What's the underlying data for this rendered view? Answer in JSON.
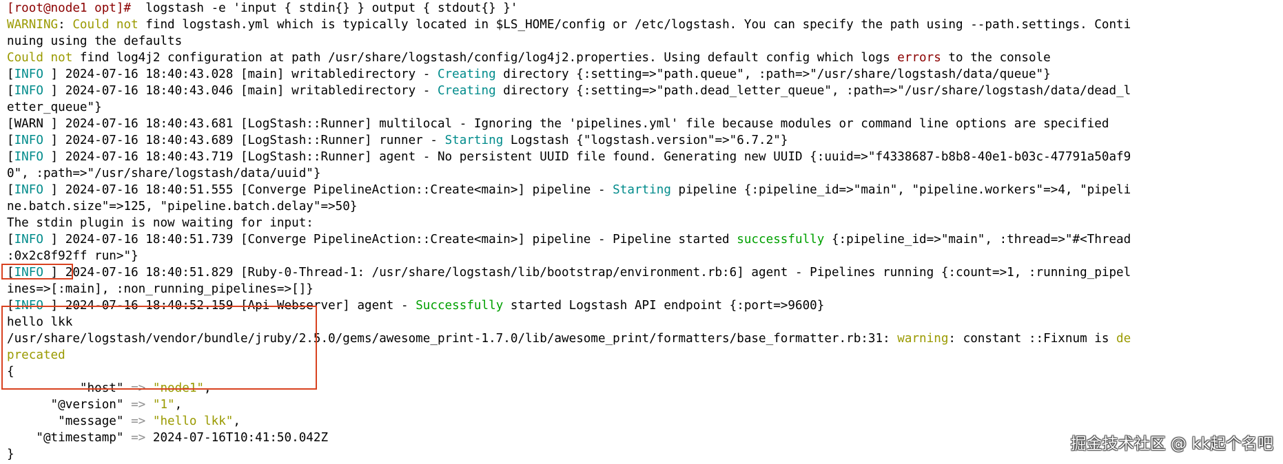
{
  "terminal": {
    "lines": [
      [
        {
          "t": "[root@node1 opt]#",
          "c": "root"
        },
        {
          "t": "  logstash -e 'input { stdin{} } output { stdout{} }'"
        }
      ],
      [
        {
          "t": "WARNING",
          "c": "olive"
        },
        {
          "t": ": "
        },
        {
          "t": "Could not",
          "c": "olive"
        },
        {
          "t": " find logstash.yml which is typically located in $LS_HOME/config or /etc/logstash. You can specify the path using --path.settings. Conti"
        }
      ],
      [
        {
          "t": "nuing using the defaults"
        }
      ],
      [
        {
          "t": "Could not",
          "c": "olive"
        },
        {
          "t": " find log4j2 configuration at path /usr/share/logstash/config/log4j2.properties. Using default config which logs "
        },
        {
          "t": "errors",
          "c": "red"
        },
        {
          "t": " to the console"
        }
      ],
      [
        {
          "t": "["
        },
        {
          "t": "INFO",
          "c": "cyan"
        },
        {
          "t": " ] 2024-07-16 18:40:43.028 [main] writabledirectory - "
        },
        {
          "t": "Creating",
          "c": "cyan"
        },
        {
          "t": " directory {:setting=>\"path.queue\", :path=>\"/usr/share/logstash/data/queue\"}"
        }
      ],
      [
        {
          "t": "["
        },
        {
          "t": "INFO",
          "c": "cyan"
        },
        {
          "t": " ] 2024-07-16 18:40:43.046 [main] writabledirectory - "
        },
        {
          "t": "Creating",
          "c": "cyan"
        },
        {
          "t": " directory {:setting=>\"path.dead_letter_queue\", :path=>\"/usr/share/logstash/data/dead_l"
        }
      ],
      [
        {
          "t": "etter_queue\"}"
        }
      ],
      [
        {
          "t": "[WARN ] 2024-07-16 18:40:43.681 [LogStash::Runner] multilocal - Ignoring the 'pipelines.yml' file because modules or command line options are specified"
        }
      ],
      [
        {
          "t": "["
        },
        {
          "t": "INFO",
          "c": "cyan"
        },
        {
          "t": " ] 2024-07-16 18:40:43.689 [LogStash::Runner] runner - "
        },
        {
          "t": "Starting",
          "c": "cyan"
        },
        {
          "t": " Logstash {\"logstash.version\"=>\"6.7.2\"}"
        }
      ],
      [
        {
          "t": "["
        },
        {
          "t": "INFO",
          "c": "cyan"
        },
        {
          "t": " ] 2024-07-16 18:40:43.719 [LogStash::Runner] agent - No persistent UUID file found. Generating new UUID {:uuid=>\"f4338687-b8b8-40e1-b03c-47791a50af9"
        }
      ],
      [
        {
          "t": "0\", :path=>\"/usr/share/logstash/data/uuid\"}"
        }
      ],
      [
        {
          "t": "["
        },
        {
          "t": "INFO",
          "c": "cyan"
        },
        {
          "t": " ] 2024-07-16 18:40:51.555 [Converge PipelineAction::Create<main>] pipeline - "
        },
        {
          "t": "Starting",
          "c": "cyan"
        },
        {
          "t": " pipeline {:pipeline_id=>\"main\", \"pipeline.workers\"=>4, \"pipeli"
        }
      ],
      [
        {
          "t": "ne.batch.size\"=>125, \"pipeline.batch.delay\"=>50}"
        }
      ],
      [
        {
          "t": "The stdin plugin is now waiting for input:"
        }
      ],
      [
        {
          "t": "["
        },
        {
          "t": "INFO",
          "c": "cyan"
        },
        {
          "t": " ] 2024-07-16 18:40:51.739 [Converge PipelineAction::Create<main>] pipeline - Pipeline started "
        },
        {
          "t": "successfully",
          "c": "green"
        },
        {
          "t": " {:pipeline_id=>\"main\", :thread=>\"#<Thread"
        }
      ],
      [
        {
          "t": ":0x2c8f92ff run>\"}"
        }
      ],
      [
        {
          "t": "["
        },
        {
          "t": "INFO",
          "c": "cyan"
        },
        {
          "t": " ] 2024-07-16 18:40:51.829 [Ruby-0-Thread-1: /usr/share/logstash/lib/bootstrap/environment.rb:6] agent - Pipelines running {:count=>1, :running_pipel"
        }
      ],
      [
        {
          "t": "ines=>[:main], :non_running_pipelines=>[]}"
        }
      ],
      [
        {
          "t": "["
        },
        {
          "t": "INFO",
          "c": "cyan"
        },
        {
          "t": " ] 2024-07-16 18:40:52.159 [Api Webserver] agent - "
        },
        {
          "t": "Successfully",
          "c": "green"
        },
        {
          "t": " started Logstash API endpoint {:port=>9600}"
        }
      ],
      [
        {
          "t": "hello lkk"
        }
      ],
      [
        {
          "t": "/usr/share/logstash/vendor/bundle/jruby/2.5.0/gems/awesome_print-1.7.0/lib/awesome_print/formatters/base_formatter.rb:31: "
        },
        {
          "t": "warning",
          "c": "olive"
        },
        {
          "t": ": constant ::Fixnum is "
        },
        {
          "t": "de",
          "c": "olive"
        }
      ],
      [
        {
          "t": "precated",
          "c": "olive"
        }
      ],
      [
        {
          "t": "{"
        }
      ],
      [
        {
          "t": "          \"host\" "
        },
        {
          "t": "=>",
          "c": "op"
        },
        {
          "t": " "
        },
        {
          "t": "\"node1\"",
          "c": "olive"
        },
        {
          "t": ","
        }
      ],
      [
        {
          "t": "      \"@version\" "
        },
        {
          "t": "=>",
          "c": "op"
        },
        {
          "t": " "
        },
        {
          "t": "\"1\"",
          "c": "olive"
        },
        {
          "t": ","
        }
      ],
      [
        {
          "t": "       \"message\" "
        },
        {
          "t": "=>",
          "c": "op"
        },
        {
          "t": " "
        },
        {
          "t": "\"hello lkk\"",
          "c": "olive"
        },
        {
          "t": ","
        }
      ],
      [
        {
          "t": "    \"@timestamp\" "
        },
        {
          "t": "=>",
          "c": "op"
        },
        {
          "t": " 2024-07-16T10:41:50.042Z"
        }
      ],
      [
        {
          "t": "}"
        }
      ]
    ]
  },
  "watermark": "掘金技术社区 @ kk起个名吧",
  "colors": {
    "prompt": "#8b0000",
    "warning": "#9a9a00",
    "info": "#008b8b",
    "success": "#00a000",
    "highlight_box": "#d8411f"
  }
}
